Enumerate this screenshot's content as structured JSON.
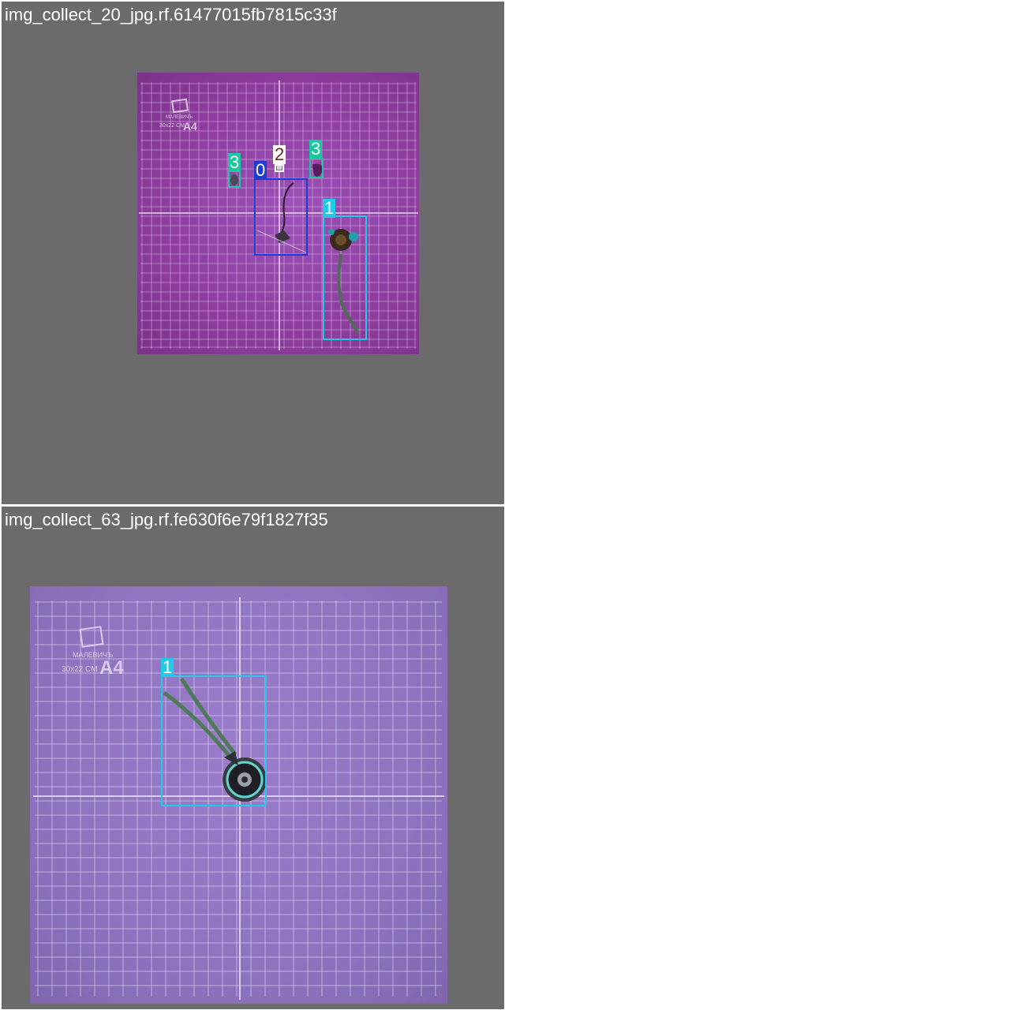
{
  "tiles": [
    {
      "title": "img_collect_20_jpg.rf.61477015fb7815c33f",
      "mat": {
        "brand": "МАЛЕВИЧЪ",
        "size": "30x22 CM",
        "format": "A4"
      },
      "detections": [
        {
          "label": "0",
          "color": "#1f3bd6"
        },
        {
          "label": "1",
          "color": "#20c9e6"
        },
        {
          "label": "2",
          "color": "#ffffff",
          "text_color": "#7a1d1d"
        },
        {
          "label": "3",
          "color": "#19c7a0"
        },
        {
          "label": "3",
          "color": "#19c7a0"
        }
      ]
    },
    {
      "title": "img_collect_63_jpg.rf.fe630f6e79f1827f35",
      "mat": {
        "brand": "МАЛЕВИЧЪ",
        "size": "30x22 CM",
        "format": "A4"
      },
      "detections": [
        {
          "label": "1",
          "color": "#20c9e6"
        }
      ]
    }
  ]
}
